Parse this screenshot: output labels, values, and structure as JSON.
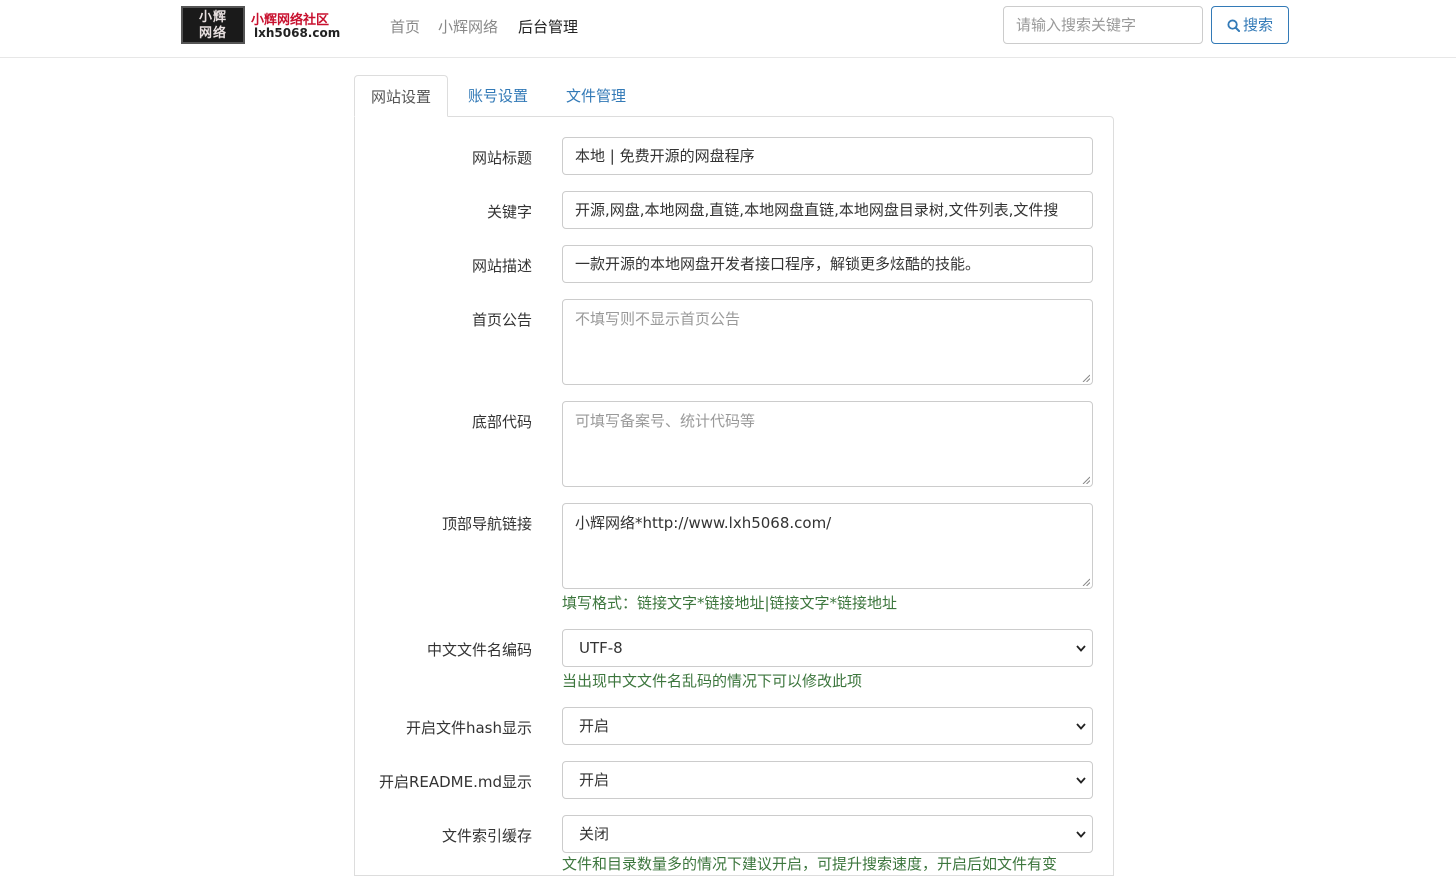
{
  "header": {
    "logo": {
      "box_line1": "小辉",
      "box_line2": "网络",
      "title": "小辉网络社区",
      "domain": "lxh5068.com"
    },
    "nav": [
      {
        "label": "首页",
        "active": false
      },
      {
        "label": "小辉网络",
        "active": false
      },
      {
        "label": "后台管理",
        "active": true
      }
    ],
    "search": {
      "placeholder": "请输入搜索关键字",
      "button_label": "搜索"
    }
  },
  "tabs": [
    {
      "label": "网站设置",
      "active": true
    },
    {
      "label": "账号设置",
      "active": false
    },
    {
      "label": "文件管理",
      "active": false
    }
  ],
  "form": {
    "site_title": {
      "label": "网站标题",
      "value": "本地 | 免费开源的网盘程序"
    },
    "keywords": {
      "label": "关键字",
      "value": "开源,网盘,本地网盘,直链,本地网盘直链,本地网盘目录树,文件列表,文件搜"
    },
    "description": {
      "label": "网站描述",
      "value": "一款开源的本地网盘开发者接口程序，解锁更多炫酷的技能。"
    },
    "notice": {
      "label": "首页公告",
      "value": "",
      "placeholder": "不填写则不显示首页公告"
    },
    "footer_code": {
      "label": "底部代码",
      "value": "",
      "placeholder": "可填写备案号、统计代码等"
    },
    "top_nav_links": {
      "label": "顶部导航链接",
      "value": "小辉网络*http://www.lxh5068.com/",
      "help": "填写格式：链接文字*链接地址|链接文字*链接地址"
    },
    "filename_encoding": {
      "label": "中文文件名编码",
      "value": "UTF-8",
      "help": "当出现中文文件名乱码的情况下可以修改此项"
    },
    "file_hash": {
      "label": "开启文件hash显示",
      "value": "开启"
    },
    "readme": {
      "label": "开启README.md显示",
      "value": "开启"
    },
    "index_cache": {
      "label": "文件索引缓存",
      "value": "关闭",
      "help": "文件和目录数量多的情况下建议开启，可提升搜索速度，开启后如文件有变"
    }
  },
  "colors": {
    "link": "#337ab7",
    "help_text": "#3c763d",
    "logo_red": "#c8102e"
  }
}
